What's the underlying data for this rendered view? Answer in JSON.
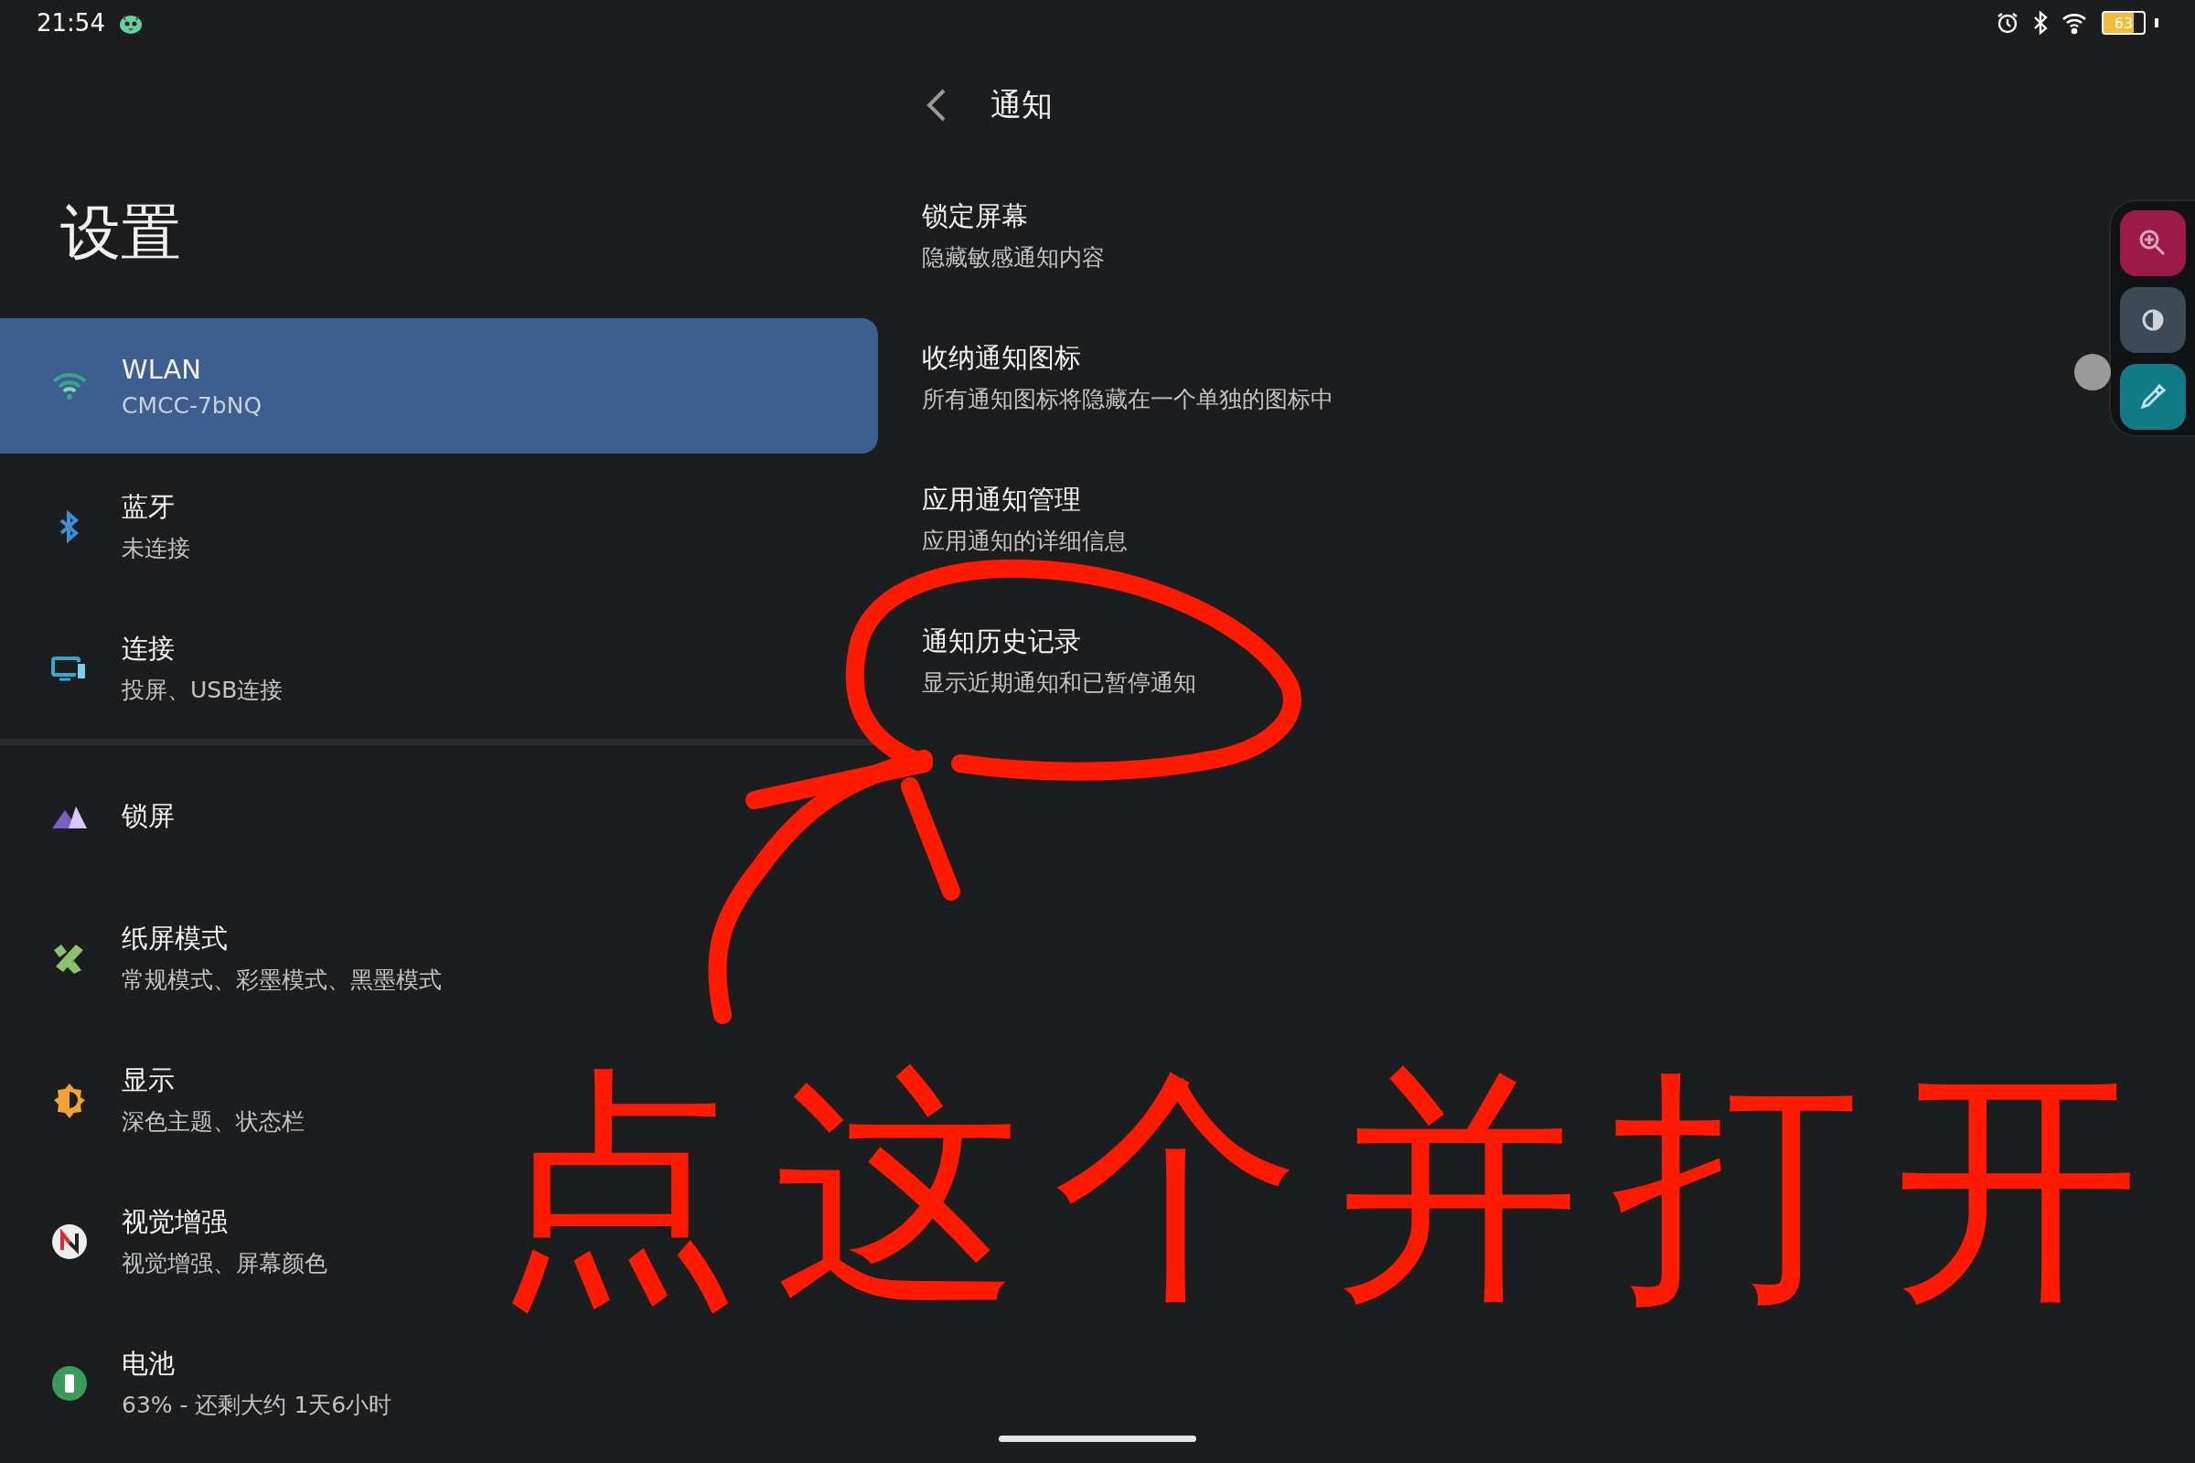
{
  "status_bar": {
    "time": "21:54",
    "battery": "63"
  },
  "settings_pane": {
    "title": "设置",
    "groups": [
      [
        {
          "title": "WLAN",
          "subtitle": "CMCC-7bNQ",
          "selected": true
        },
        {
          "title": "蓝牙",
          "subtitle": "未连接",
          "selected": false
        },
        {
          "title": "连接",
          "subtitle": "投屏、USB连接",
          "selected": false
        }
      ],
      [
        {
          "title": "锁屏",
          "selected": false
        },
        {
          "title": "纸屏模式",
          "subtitle": "常规模式、彩墨模式、黑墨模式",
          "selected": false
        },
        {
          "title": "显示",
          "subtitle": "深色主题、状态栏",
          "selected": false
        },
        {
          "title": "视觉增强",
          "subtitle": "视觉增强、屏幕颜色",
          "selected": false
        },
        {
          "title": "电池",
          "subtitle": "63% - 还剩大约 1天6小时",
          "selected": false
        }
      ]
    ]
  },
  "detail_pane": {
    "title": "通知",
    "items": [
      {
        "title": "锁定屏幕",
        "subtitle": "隐藏敏感通知内容"
      },
      {
        "title": "收纳通知图标",
        "subtitle": "所有通知图标将隐藏在一个单独的图标中"
      },
      {
        "title": "应用通知管理",
        "subtitle": "应用通知的详细信息"
      },
      {
        "title": "通知历史记录",
        "subtitle": "显示近期通知和已暂停通知"
      }
    ]
  },
  "annotation": {
    "text": "点这个并打开"
  }
}
